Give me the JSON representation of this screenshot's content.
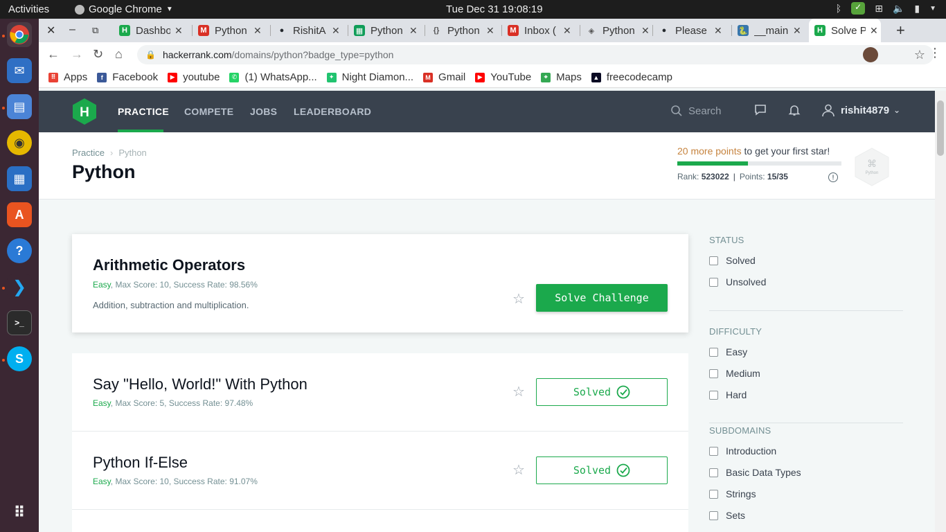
{
  "system": {
    "activities": "Activities",
    "app_name": "Google Chrome",
    "clock": "Tue Dec 31  19:08:19"
  },
  "tabs": [
    {
      "title": "Dashbo",
      "icon": "hackerrank-icon",
      "color": "#1ba94c"
    },
    {
      "title": "Python",
      "icon": "gmail-icon",
      "color": "#d93025"
    },
    {
      "title": "RishitA",
      "icon": "github-icon",
      "color": "#24292e"
    },
    {
      "title": "Python",
      "icon": "sheets-icon",
      "color": "#0f9d58"
    },
    {
      "title": "Python",
      "icon": "code-icon",
      "color": "#555555"
    },
    {
      "title": "Inbox (",
      "icon": "gmail-icon",
      "color": "#d93025"
    },
    {
      "title": "Python",
      "icon": "diamond-icon",
      "color": "#555555"
    },
    {
      "title": "Please",
      "icon": "github-icon",
      "color": "#24292e"
    },
    {
      "title": "__main",
      "icon": "python-icon",
      "color": "#3776ab"
    },
    {
      "title": "Solve P",
      "icon": "hackerrank-icon",
      "color": "#1ba94c",
      "active": true
    }
  ],
  "url": {
    "host": "hackerrank.com",
    "path": "/domains/python?badge_type=python"
  },
  "bookmarks": [
    {
      "label": "Apps",
      "icon": "apps-grid-icon",
      "color": "#e94235"
    },
    {
      "label": "Facebook",
      "icon": "facebook-icon",
      "color": "#3b5998"
    },
    {
      "label": "youtube",
      "icon": "youtube-icon",
      "color": "#ff0000"
    },
    {
      "label": "(1) WhatsApp...",
      "icon": "whatsapp-icon",
      "color": "#25d366"
    },
    {
      "label": "Night Diamon...",
      "icon": "night-diamond-icon",
      "color": "#21c36f"
    },
    {
      "label": "Gmail",
      "icon": "gmail-icon",
      "color": "#d93025"
    },
    {
      "label": "YouTube",
      "icon": "youtube-icon",
      "color": "#ff0000"
    },
    {
      "label": "Maps",
      "icon": "maps-icon",
      "color": "#34a853"
    },
    {
      "label": "freecodecamp",
      "icon": "freecodecamp-icon",
      "color": "#0a0a23"
    }
  ],
  "nav": {
    "links": [
      "PRACTICE",
      "COMPETE",
      "JOBS",
      "LEADERBOARD"
    ],
    "search_placeholder": "Search",
    "username": "rishit4879"
  },
  "header": {
    "breadcrumb": [
      "Practice",
      "Python"
    ],
    "title": "Python",
    "points_more": "20 more points",
    "points_rest": " to get your first star!",
    "progress": 0.43,
    "rank_label": "Rank:",
    "rank": "523022",
    "points_label": "Points:",
    "points": "15/35",
    "badge_label": "Python"
  },
  "challenges": [
    {
      "title": "Arithmetic Operators",
      "difficulty": "Easy",
      "rest": ", Max Score: 10, Success Rate: 98.56%",
      "desc": "Addition, subtraction and multiplication.",
      "button": "Solve Challenge"
    },
    {
      "title": "Say \"Hello, World!\" With Python",
      "difficulty": "Easy",
      "rest": ", Max Score: 5, Success Rate: 97.48%",
      "button": "Solved"
    },
    {
      "title": "Python If-Else",
      "difficulty": "Easy",
      "rest": ", Max Score: 10, Success Rate: 91.07%",
      "button": "Solved"
    }
  ],
  "filters": {
    "status": {
      "title": "STATUS",
      "items": [
        "Solved",
        "Unsolved"
      ]
    },
    "difficulty": {
      "title": "DIFFICULTY",
      "items": [
        "Easy",
        "Medium",
        "Hard"
      ]
    },
    "subdomains": {
      "title": "SUBDOMAINS",
      "items": [
        "Introduction",
        "Basic Data Types",
        "Strings",
        "Sets"
      ]
    }
  },
  "colors": {
    "hr_green": "#1ba94c",
    "hr_nav": "#39424e",
    "points_orange": "#c6833e"
  }
}
